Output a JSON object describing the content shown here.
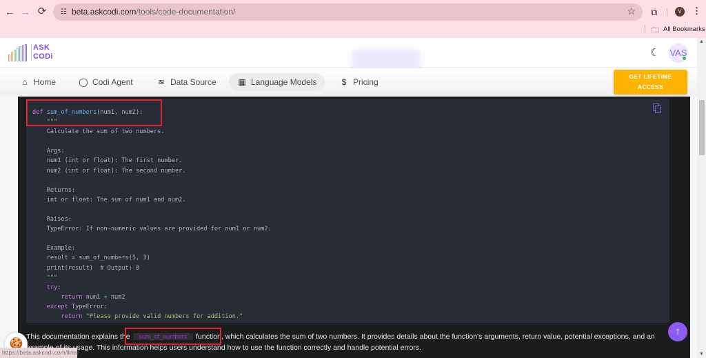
{
  "browser": {
    "url_host": "beta.askcodi.com",
    "url_path": "/tools/code-documentation/",
    "profile_initial": "V",
    "bookmarks_label": "All Bookmarks",
    "status_bar_url": "https://beta.askcodi.com/llms/",
    "icons": {
      "back": "←",
      "forward": "→",
      "reload": "⟳",
      "site_info": "☷",
      "star": "☆",
      "extensions": "⧉",
      "menu": "⋮",
      "folder": "🗀"
    }
  },
  "header": {
    "logo_line1": "ASK",
    "logo_line2": "CODi",
    "theme_toggle_icon": "☾",
    "avatar_initials": "VAS",
    "avatar_status_color": "#3cc13c"
  },
  "nav": {
    "items": [
      {
        "label": "Home",
        "icon": "⌂",
        "active": false
      },
      {
        "label": "Codi Agent",
        "icon": "◯",
        "active": false
      },
      {
        "label": "Data Source",
        "icon": "≋",
        "active": false
      },
      {
        "label": "Language Models",
        "icon": "▦",
        "active": true
      },
      {
        "label": "Pricing",
        "icon": "$",
        "active": false
      }
    ],
    "cta_line1": "GET LIFETIME",
    "cta_line2": "ACCESS"
  },
  "code": {
    "language": "python",
    "lines": [
      [
        {
          "t": "def ",
          "c": "kw"
        },
        {
          "t": "sum_of_numbers",
          "c": "fn"
        },
        {
          "t": "(num1, num2):",
          "c": ""
        }
      ],
      [
        {
          "t": "    \"\"\"",
          "c": "str"
        }
      ],
      [
        {
          "t": "    Calculate the sum of two numbers.",
          "c": ""
        }
      ],
      [
        {
          "t": "",
          "c": ""
        }
      ],
      [
        {
          "t": "    Args:",
          "c": ""
        }
      ],
      [
        {
          "t": "    num1 (int or float): The first number.",
          "c": ""
        }
      ],
      [
        {
          "t": "    num2 (int or float): The second number.",
          "c": ""
        }
      ],
      [
        {
          "t": "",
          "c": ""
        }
      ],
      [
        {
          "t": "    Returns:",
          "c": ""
        }
      ],
      [
        {
          "t": "    int or float: The sum of num1 and num2.",
          "c": ""
        }
      ],
      [
        {
          "t": "",
          "c": ""
        }
      ],
      [
        {
          "t": "    Raises:",
          "c": ""
        }
      ],
      [
        {
          "t": "    TypeError: If non-numeric values are provided for num1 or num2.",
          "c": ""
        }
      ],
      [
        {
          "t": "",
          "c": ""
        }
      ],
      [
        {
          "t": "    Example:",
          "c": ""
        }
      ],
      [
        {
          "t": "    result = sum_of_numbers(5, 3)",
          "c": ""
        }
      ],
      [
        {
          "t": "    print(result)  # Output: 8",
          "c": ""
        }
      ],
      [
        {
          "t": "    \"\"\"",
          "c": "str"
        }
      ],
      [
        {
          "t": "    try",
          "c": "kw"
        },
        {
          "t": ":",
          "c": ""
        }
      ],
      [
        {
          "t": "        return ",
          "c": "kw"
        },
        {
          "t": "num1 ",
          "c": ""
        },
        {
          "t": "+",
          "c": "op"
        },
        {
          "t": " num2",
          "c": ""
        }
      ],
      [
        {
          "t": "    except ",
          "c": "kw"
        },
        {
          "t": "TypeError:",
          "c": ""
        }
      ],
      [
        {
          "t": "        return ",
          "c": "kw"
        },
        {
          "t": "\"Please provide valid numbers for addition.\"",
          "c": "str"
        }
      ]
    ],
    "copy_icon": "copy"
  },
  "description": {
    "before": "This documentation explains the",
    "inline_code": "`sum_of_numbers`",
    "after": "function, which calculates the sum of two numbers. It provides details about the function's arguments, return value, potential exceptions, and an example of its usage. This information helps users understand how to use the function correctly and handle potential errors."
  },
  "floating": {
    "scroll_top_icon": "↑",
    "cookie_icon": "🍪"
  },
  "colors": {
    "accent": "#8a5cf0",
    "cta": "#fcb400",
    "highlight": "#e0242f",
    "code_bg": "#282c34"
  }
}
